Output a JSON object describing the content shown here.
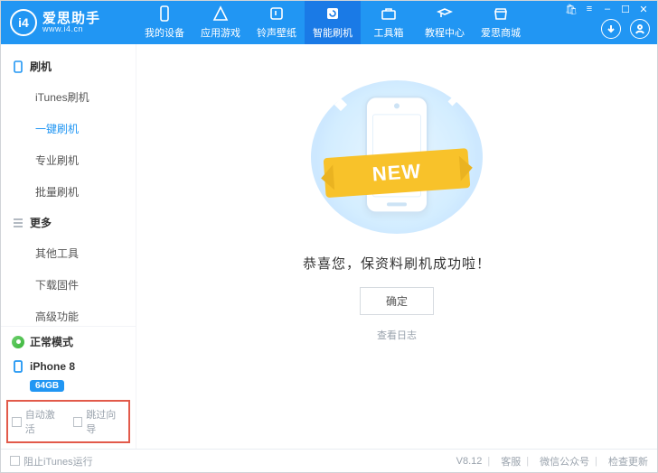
{
  "app": {
    "name": "爱思助手",
    "url": "www.i4.cn",
    "logo_letters": "i4"
  },
  "window_controls": [
    "cart",
    "menu",
    "min",
    "max",
    "close"
  ],
  "nav": [
    {
      "label": "我的设备",
      "icon": "device"
    },
    {
      "label": "应用游戏",
      "icon": "apps"
    },
    {
      "label": "铃声壁纸",
      "icon": "note"
    },
    {
      "label": "智能刷机",
      "icon": "refresh",
      "active": true
    },
    {
      "label": "工具箱",
      "icon": "toolbox"
    },
    {
      "label": "教程中心",
      "icon": "grad"
    },
    {
      "label": "爱思商城",
      "icon": "shop"
    }
  ],
  "sidebar": {
    "sections": [
      {
        "title": "刷机",
        "items": [
          "iTunes刷机",
          "一键刷机",
          "专业刷机",
          "批量刷机"
        ],
        "active_index": 1
      },
      {
        "title": "更多",
        "items": [
          "其他工具",
          "下载固件",
          "高级功能"
        ]
      }
    ],
    "mode": "正常模式",
    "device": {
      "name": "iPhone 8",
      "capacity": "64GB"
    },
    "checks": [
      {
        "label": "自动激活"
      },
      {
        "label": "跳过向导"
      }
    ]
  },
  "main": {
    "ribbon": "NEW",
    "message": "恭喜您，保资料刷机成功啦！",
    "ok": "确定",
    "log": "查看日志"
  },
  "footer": {
    "block_itunes": "阻止iTunes运行",
    "version": "V8.12",
    "items": [
      "客服",
      "微信公众号",
      "检查更新"
    ]
  }
}
